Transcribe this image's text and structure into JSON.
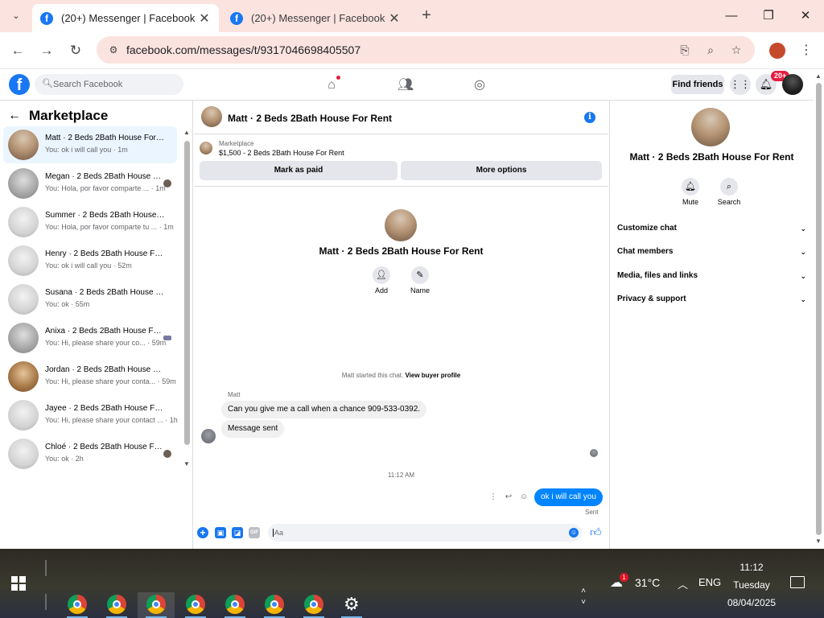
{
  "browser": {
    "tabs": [
      {
        "title": "(20+) Messenger | Facebook",
        "active": true
      },
      {
        "title": "(20+) Messenger | Facebook",
        "active": false
      }
    ],
    "url": "facebook.com/messages/t/9317046698405507"
  },
  "fb_header": {
    "search_placeholder": "Search Facebook",
    "find_friends": "Find friends",
    "notification_badge": "20+"
  },
  "left_panel": {
    "title": "Marketplace",
    "conversations": [
      {
        "name": "Matt · 2 Beds 2Bath House For Rent",
        "preview": "You: ok i will call you · 1m",
        "active": true
      },
      {
        "name": "Megan · 2 Beds 2Bath House For Rent",
        "preview": "You: Hola, por favor comparte ... · 1m"
      },
      {
        "name": "Summer · 2 Beds 2Bath House For Rent",
        "preview": "You: Hola, por favor comparte tu ... · 1m"
      },
      {
        "name": "Henry · 2 Beds 2Bath House For Rent",
        "preview": "You: ok i will call you · 52m"
      },
      {
        "name": "Susana · 2 Beds 2Bath House For Rent",
        "preview": "You: ok · 55m"
      },
      {
        "name": "Anixa · 2 Beds 2Bath House For Rent",
        "preview": "You: Hi, please share your co... · 59m"
      },
      {
        "name": "Jordan · 2 Beds 2Bath House For Rent",
        "preview": "You: Hi, please share your conta... · 59m"
      },
      {
        "name": "Jayee · 2 Beds 2Bath House For Rent",
        "preview": "You: Hi, please share your contact ... · 1h"
      },
      {
        "name": "Chloé · 2 Beds 2Bath House For Rent",
        "preview": "You: ok · 2h"
      }
    ]
  },
  "chat": {
    "title": "Matt · 2 Beds 2Bath House For Rent",
    "marketplace_label": "Marketplace",
    "listing": "$1,500 - 2 Beds 2Bath House For Rent",
    "mark_as_paid": "Mark as paid",
    "more_options": "More options",
    "profile_name": "Matt · 2 Beds 2Bath House For Rent",
    "action_add": "Add",
    "action_name": "Name",
    "system_message": "Matt started this chat.",
    "view_buyer_profile": "View buyer profile",
    "sender_name": "Matt",
    "incoming": [
      "Can you give me a call when a chance 909-533-0392.",
      "Message sent"
    ],
    "timestamp": "11:12 AM",
    "outgoing": "ok i will call you",
    "sent_label": "Sent",
    "composer_placeholder": "Aa"
  },
  "right_panel": {
    "name": "Matt · 2 Beds 2Bath House For Rent",
    "mute": "Mute",
    "search": "Search",
    "sections": [
      "Customize chat",
      "Chat members",
      "Media, files and links",
      "Privacy & support"
    ]
  },
  "taskbar": {
    "weather_temp": "31°C",
    "weather_badge": "1",
    "language": "ENG",
    "time": "11:12",
    "day": "Tuesday",
    "date": "08/04/2025"
  }
}
